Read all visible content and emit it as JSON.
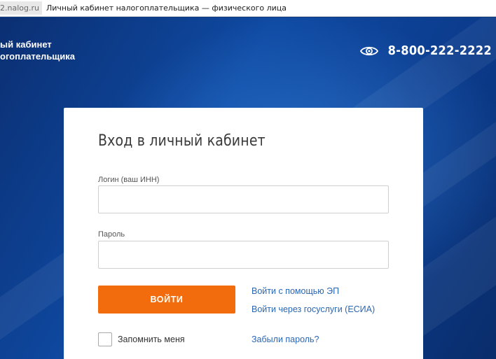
{
  "browser": {
    "url_fragment": "2.nalog.ru",
    "tab_title": "Личный кабинет налогоплательщика — физического лица"
  },
  "header": {
    "brand_line1": "ый кабинет",
    "brand_line2": "огоплательщика",
    "accessibility_icon": "eye-icon",
    "phone": "8-800-222-2222"
  },
  "login": {
    "title": "Вход в личный кабинет",
    "login_label": "Логин (ваш ИНН)",
    "login_value": "",
    "password_label": "Пароль",
    "password_value": "",
    "submit_label": "ВОЙТИ",
    "link_ep": "Войти с помощью ЭП",
    "link_esia": "Войти через госуслуги (ЕСИА)",
    "remember_label": "Запомнить меня",
    "remember_checked": false,
    "forgot_link": "Забыли пароль?"
  },
  "colors": {
    "background": "#0f4aa3",
    "button": "#f26c0d",
    "link": "#2a66b3"
  }
}
